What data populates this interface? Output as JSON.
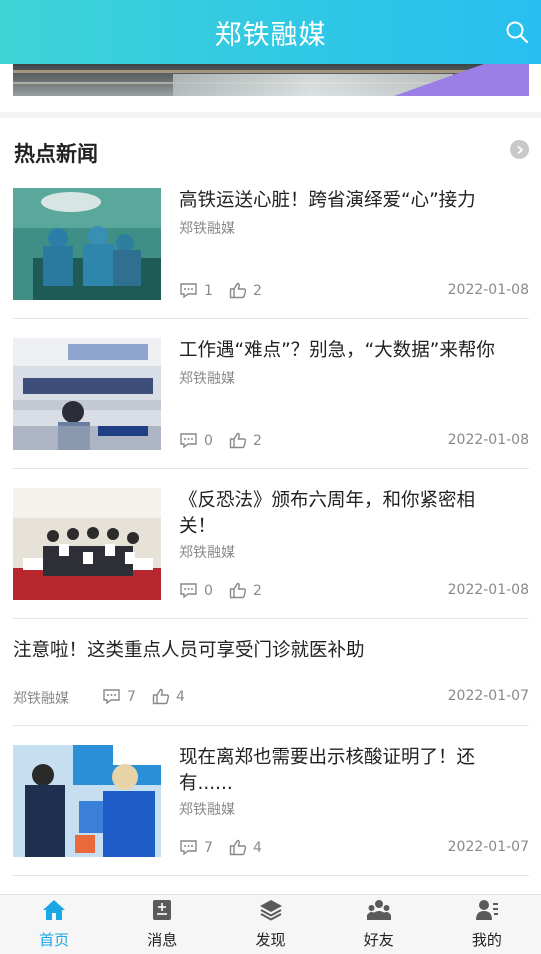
{
  "header": {
    "title": "郑铁融媒"
  },
  "section": {
    "title": "热点新闻"
  },
  "news": [
    {
      "title": "高铁运送心脏！跨省演绎爱“心”接力",
      "source": "郑铁融媒",
      "comments": "1",
      "likes": "2",
      "date": "2022-01-08"
    },
    {
      "title": "工作遇“难点”？别急，“大数据”来帮你",
      "source": "郑铁融媒",
      "comments": "0",
      "likes": "2",
      "date": "2022-01-08"
    },
    {
      "title": "《反恐法》颁布六周年，和你紧密相关！",
      "source": "郑铁融媒",
      "comments": "0",
      "likes": "2",
      "date": "2022-01-08"
    },
    {
      "title": "注意啦！这类重点人员可享受门诊就医补助",
      "source": "郑铁融媒",
      "comments": "7",
      "likes": "4",
      "date": "2022-01-07"
    },
    {
      "title": "现在离郑也需要出示核酸证明了！还有......",
      "source": "郑铁融媒",
      "comments": "7",
      "likes": "4",
      "date": "2022-01-07"
    }
  ],
  "tabs": [
    {
      "label": "首页",
      "icon": "home-icon",
      "active": true
    },
    {
      "label": "消息",
      "icon": "message-icon"
    },
    {
      "label": "发现",
      "icon": "discover-icon"
    },
    {
      "label": "好友",
      "icon": "friends-icon"
    },
    {
      "label": "我的",
      "icon": "profile-icon"
    }
  ],
  "colors": {
    "accent": "#1aa7e6",
    "header_start": "#3ed3d6",
    "header_end": "#28bff0",
    "meta_text": "#8a8a8a"
  }
}
